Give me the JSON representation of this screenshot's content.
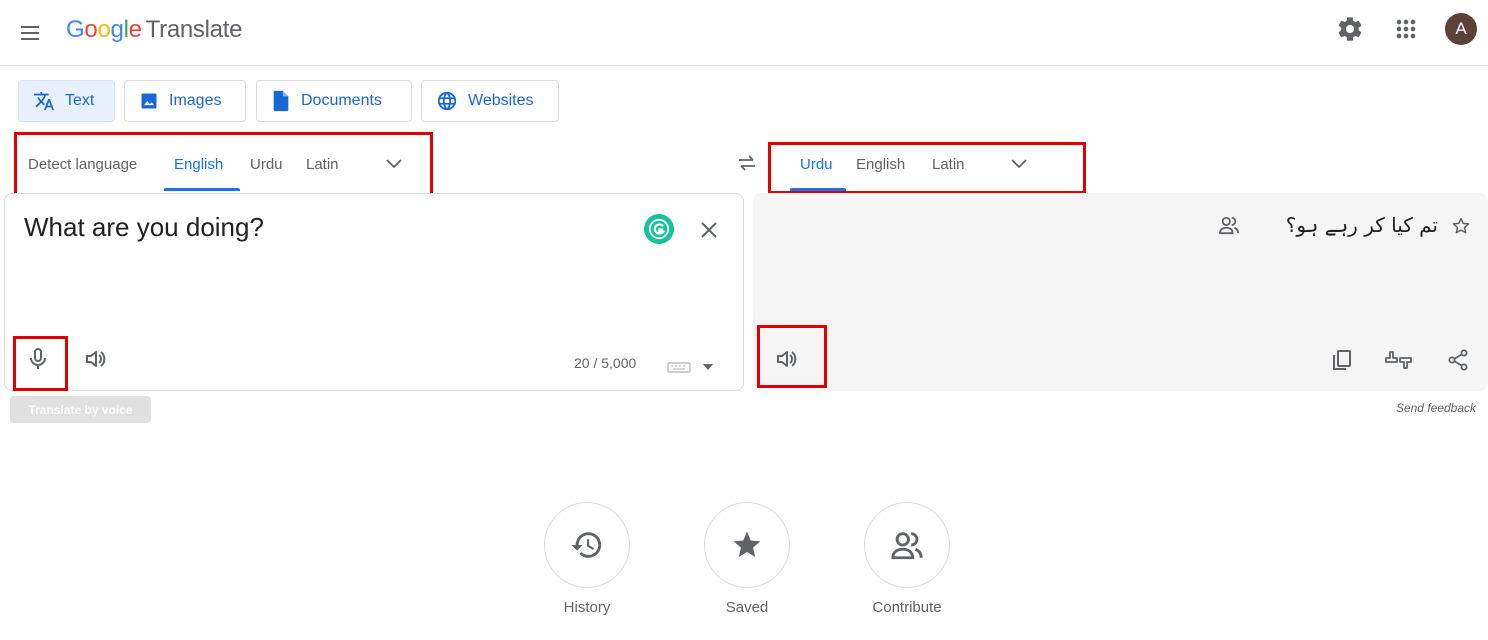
{
  "header": {
    "logo_letters": [
      "G",
      "o",
      "o",
      "g",
      "l",
      "e"
    ],
    "product_name": "Translate",
    "avatar_letter": "A",
    "avatar_color": "#5d4037"
  },
  "mode_tabs": [
    {
      "label": "Text",
      "icon": "translate-icon",
      "active": true
    },
    {
      "label": "Images",
      "icon": "image-icon",
      "active": false
    },
    {
      "label": "Documents",
      "icon": "document-icon",
      "active": false
    },
    {
      "label": "Websites",
      "icon": "globe-icon",
      "active": false
    }
  ],
  "source_languages": {
    "items": [
      "Detect language",
      "English",
      "Urdu",
      "Latin"
    ],
    "selected": "English"
  },
  "target_languages": {
    "items": [
      "Urdu",
      "English",
      "Latin"
    ],
    "selected": "Urdu"
  },
  "source": {
    "text": "What are you doing?",
    "char_count": "20 / 5,000"
  },
  "target": {
    "text": "تم کیا کر رہے ہو؟"
  },
  "tooltip": "Translate by voice",
  "send_feedback": "Send feedback",
  "bottom_actions": [
    {
      "label": "History",
      "icon": "history-icon"
    },
    {
      "label": "Saved",
      "icon": "star-icon"
    },
    {
      "label": "Contribute",
      "icon": "people-icon"
    }
  ],
  "colors": {
    "accent": "#1a73e8",
    "highlight_box": "#e00000"
  }
}
